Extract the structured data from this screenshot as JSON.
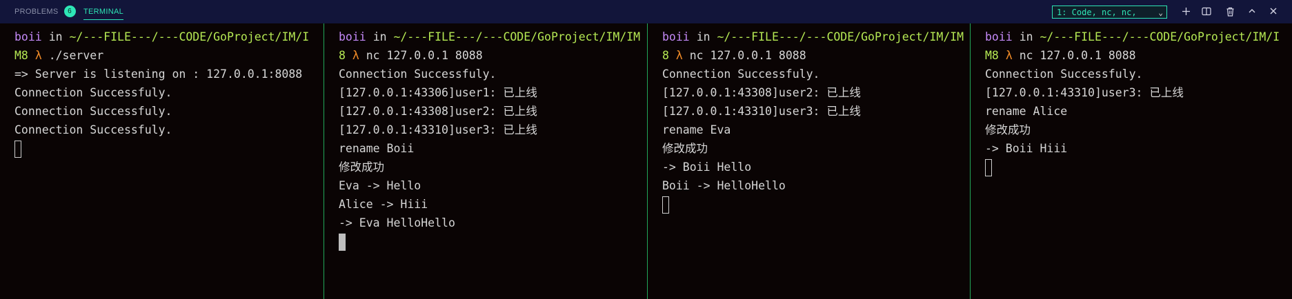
{
  "panel": {
    "tabs": [
      {
        "label": "PROBLEMS",
        "badge": "6"
      },
      {
        "label": "TERMINAL"
      }
    ],
    "terminal_select": "1: Code, nc, nc,",
    "icons": [
      "plus-icon",
      "split-icon",
      "trash-icon",
      "chevron-up-icon",
      "close-icon"
    ],
    "colors": {
      "background": "#0a0404",
      "topbar": "#12153a",
      "accent": "#2ee6b6",
      "user": "#c58af9",
      "path": "#b5e853",
      "lambda": "#f28c28",
      "divider": "#22a85a"
    }
  },
  "panes": [
    {
      "prompt": {
        "user": "boii",
        "in": "in",
        "path_line1": "~/---FILE---/---CODE/GoProject/IM/I",
        "path_line2": "M8",
        "lambda": "λ",
        "command": "./server"
      },
      "output": [
        "=> Server is listening on : 127.0.0.1:8088",
        "Connection Successfuly.",
        "Connection Successfuly.",
        "Connection Successfuly."
      ],
      "cursor": "hollow"
    },
    {
      "prompt": {
        "user": "boii",
        "in": "in",
        "path_line1": "~/---FILE---/---CODE/GoProject/IM/IM",
        "path_line2": "8",
        "lambda": "λ",
        "command": "nc 127.0.0.1 8088"
      },
      "output": [
        "Connection Successfuly.",
        "[127.0.0.1:43306]user1: 已上线",
        "[127.0.0.1:43308]user2: 已上线",
        "[127.0.0.1:43310]user3: 已上线",
        "rename Boii",
        "修改成功",
        "Eva -> Hello",
        "Alice -> Hiii",
        "-> Eva HelloHello"
      ],
      "cursor": "block"
    },
    {
      "prompt": {
        "user": "boii",
        "in": "in",
        "path_line1": "~/---FILE---/---CODE/GoProject/IM/IM",
        "path_line2": "8",
        "lambda": "λ",
        "command": "nc 127.0.0.1 8088"
      },
      "output": [
        "Connection Successfuly.",
        "[127.0.0.1:43308]user2: 已上线",
        "[127.0.0.1:43310]user3: 已上线",
        "rename Eva",
        "修改成功",
        "-> Boii Hello",
        "Boii -> HelloHello"
      ],
      "cursor": "hollow"
    },
    {
      "prompt": {
        "user": "boii",
        "in": "in",
        "path_line1": "~/---FILE---/---CODE/GoProject/IM/I",
        "path_line2": "M8",
        "lambda": "λ",
        "command": "nc 127.0.0.1 8088"
      },
      "output": [
        "Connection Successfuly.",
        "[127.0.0.1:43310]user3: 已上线",
        "rename Alice",
        "修改成功",
        "-> Boii Hiii"
      ],
      "cursor": "hollow"
    }
  ]
}
